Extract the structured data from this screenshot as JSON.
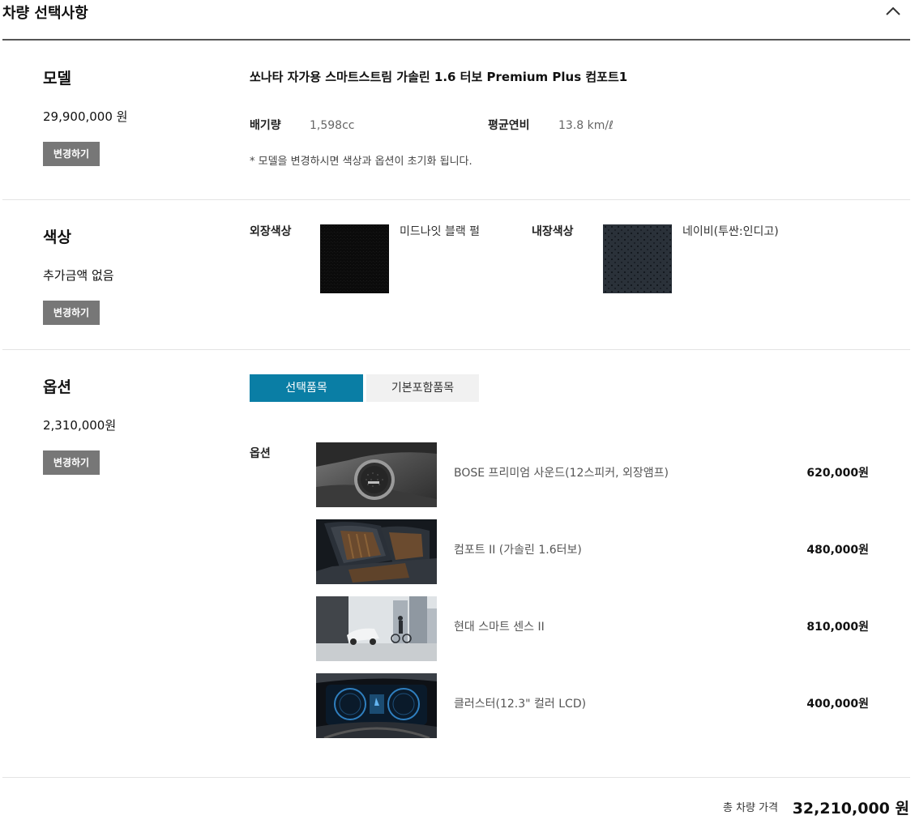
{
  "header": {
    "title": "차량 선택사항",
    "collapse_icon": "chevron-up-icon"
  },
  "model": {
    "title": "모델",
    "price": "29,900,000 원",
    "change_label": "변경하기",
    "name": "쏘나타 자가용 스마트스트림 가솔린 1.6 터보 Premium Plus 컴포트1",
    "displacement_label": "배기량",
    "displacement_value": "1,598cc",
    "efficiency_label": "평균연비",
    "efficiency_value": "13.8 km/ℓ",
    "note": "* 모델을 변경하시면 색상과 옵션이 초기화 됩니다."
  },
  "color": {
    "title": "색상",
    "price": "추가금액 없음",
    "change_label": "변경하기",
    "exterior_label": "외장색상",
    "exterior_name": "미드나잇 블랙 펄",
    "interior_label": "내장색상",
    "interior_name": "네이비(투싼:인디고)",
    "exterior_color": "#0c0c0c",
    "interior_color": "#2b323a"
  },
  "options": {
    "title": "옵션",
    "price": "2,310,000원",
    "change_label": "변경하기",
    "tabs": [
      {
        "label": "선택품목",
        "active": true
      },
      {
        "label": "기본포함품목",
        "active": false
      }
    ],
    "list_label": "옵션",
    "items": [
      {
        "name": "BOSE 프리미엄 사운드(12스피커, 외장앰프)",
        "price": "620,000원",
        "thumb": "bose-speaker"
      },
      {
        "name": "컴포트 II (가솔린 1.6터보)",
        "price": "480,000원",
        "thumb": "ventilated-seat"
      },
      {
        "name": "현대 스마트 센스  II",
        "price": "810,000원",
        "thumb": "smart-sense-scene"
      },
      {
        "name": "클러스터(12.3\" 컬러 LCD)",
        "price": "400,000원",
        "thumb": "digital-cluster"
      }
    ]
  },
  "total": {
    "label": "총 차량 가격",
    "value": "32,210,000 원"
  },
  "accent_color": "#0a7ea5"
}
